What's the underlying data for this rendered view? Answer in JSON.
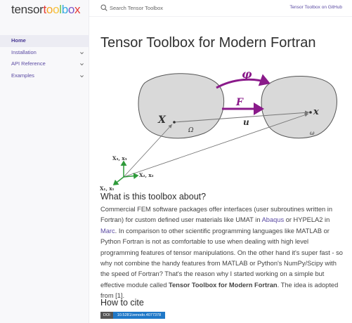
{
  "logo": {
    "letters": [
      {
        "ch": "t",
        "color": "#3a3a3a"
      },
      {
        "ch": "e",
        "color": "#3a3a3a"
      },
      {
        "ch": "n",
        "color": "#3a3a3a"
      },
      {
        "ch": "s",
        "color": "#3a3a3a"
      },
      {
        "ch": "o",
        "color": "#3a3a3a"
      },
      {
        "ch": "r",
        "color": "#3a3a3a"
      },
      {
        "ch": "t",
        "color": "#e53935"
      },
      {
        "ch": "o",
        "color": "#f6a623"
      },
      {
        "ch": "o",
        "color": "#f6c23c"
      },
      {
        "ch": "l",
        "color": "#6cc04a"
      },
      {
        "ch": "b",
        "color": "#31a8e0"
      },
      {
        "ch": "o",
        "color": "#7b55c7"
      },
      {
        "ch": "x",
        "color": "#e53935"
      }
    ]
  },
  "search": {
    "placeholder": "Search Tensor Toolbox"
  },
  "header": {
    "github_link": "Tensor Toolbox on GitHub"
  },
  "nav": {
    "items": [
      {
        "label": "Home",
        "active": true,
        "expandable": false
      },
      {
        "label": "Installation",
        "active": false,
        "expandable": true
      },
      {
        "label": "API Reference",
        "active": false,
        "expandable": true
      },
      {
        "label": "Examples",
        "active": false,
        "expandable": true
      }
    ]
  },
  "page": {
    "title": "Tensor Toolbox for Modern Fortran",
    "section1_heading": "What is this toolbox about?",
    "para_parts": [
      {
        "t": "Commercial FEM software packages offer interfaces (user subroutines written in Fortran) for custom defined user materials like UMAT in "
      },
      {
        "t": "Abaqus",
        "link": true
      },
      {
        "t": " or HYPELA2 in "
      },
      {
        "t": "Marc",
        "link": true
      },
      {
        "t": ". In comparison to other scientific programming languages like MATLAB or Python Fortran is not as comfortable to use when dealing with high level programming features of tensor manipulations. On the other hand it's super fast - so why not combine the handy features from MATLAB or Python's NumPy/Scipy with the speed of Fortran? That's the reason why I started working on a simple but effective module called "
      },
      {
        "t": "Tensor Toolbox for Modern Fortran",
        "bold": true
      },
      {
        "t": ". The idea is adopted from [1]."
      }
    ],
    "section2_heading": "How to cite",
    "badge": {
      "left": "DOI",
      "right": "10.5281/zenodo.4077378"
    }
  },
  "diagram": {
    "labels": {
      "X": "X",
      "Omega": "Ω",
      "x": "x",
      "omega": "ω",
      "phi": "φ",
      "F": "F",
      "u": "u",
      "e3": "X₃, x₃",
      "e2": "X₂, x₂",
      "e1": "X₁, x₁"
    },
    "colors": {
      "arrow": "#8a1a8a",
      "axes": "#2e9a3a",
      "body": "#d9d9d9",
      "line": "#777777"
    }
  }
}
